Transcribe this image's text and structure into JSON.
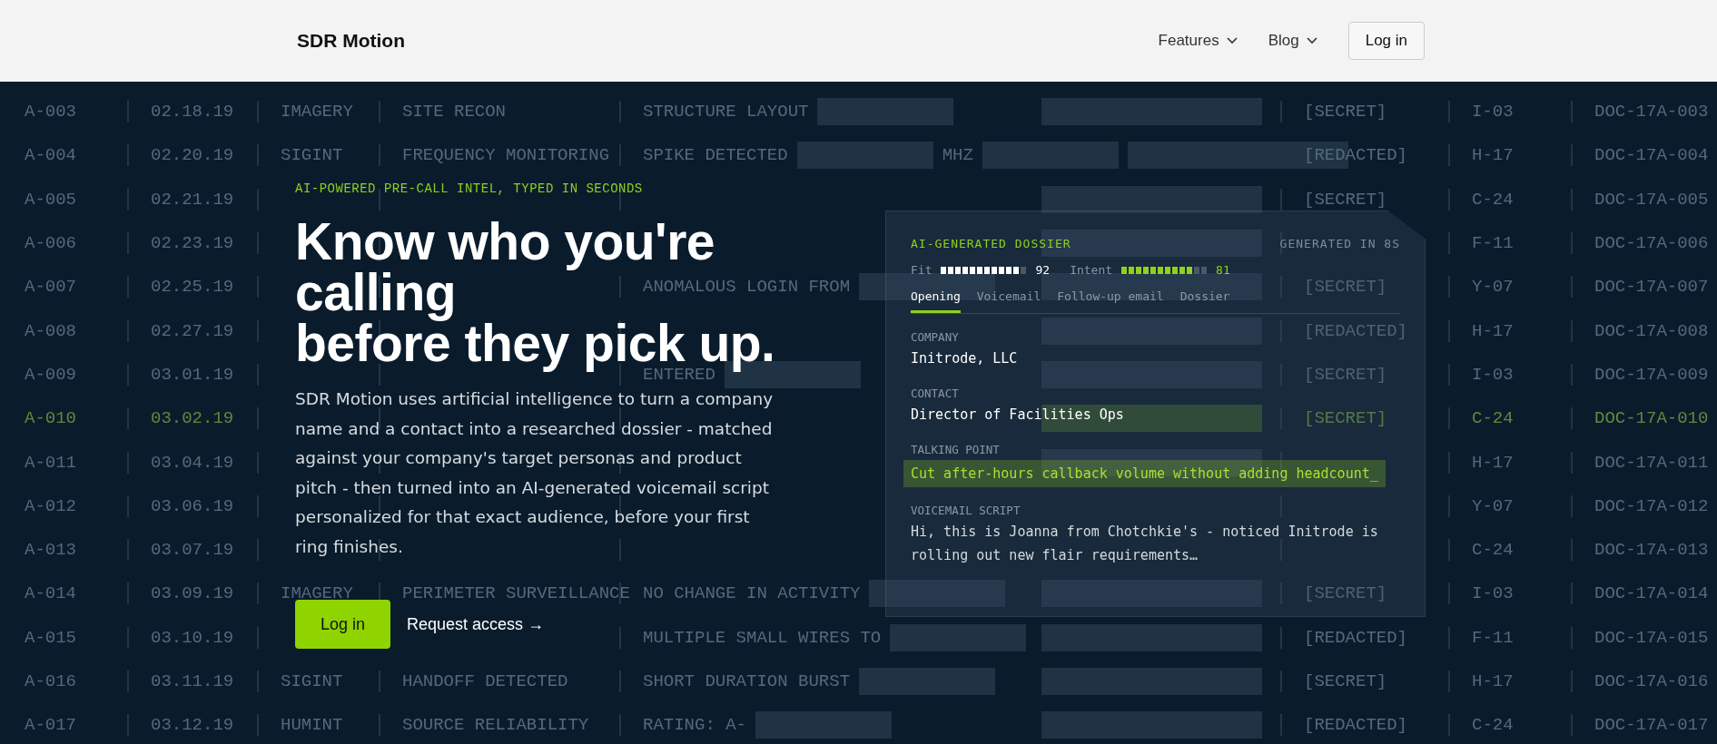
{
  "nav": {
    "logo": "SDR Motion",
    "menus": [
      {
        "label": "Features"
      },
      {
        "label": "Blog"
      }
    ],
    "login": "Log in"
  },
  "log_rows": [
    {
      "id": "A-003",
      "date": "02.18.19",
      "type": "IMAGERY",
      "activity": "SITE RECON",
      "finding": [
        "STRUCTURE LAYOUT"
      ],
      "class": "[SECRET]",
      "code": "I-03",
      "doc": "DOC-17A-003",
      "highlighted": false,
      "tail_bar": true
    },
    {
      "id": "A-004",
      "date": "02.20.19",
      "type": "SIGINT",
      "activity": "FREQUENCY MONITORING",
      "finding": [
        "SPIKE DETECTED",
        "MHZ"
      ],
      "class": "[REDACTED]",
      "code": "H-17",
      "doc": "DOC-17A-004",
      "highlighted": false,
      "tail_bar": true
    },
    {
      "id": "A-005",
      "date": "02.21.19",
      "class": "[SECRET]",
      "code": "C-24",
      "doc": "DOC-17A-005",
      "highlighted": false,
      "tail_bar": true
    },
    {
      "id": "A-006",
      "date": "02.23.19",
      "code": "F-11",
      "doc": "DOC-17A-006",
      "highlighted": false,
      "tail_bar": true
    },
    {
      "id": "A-007",
      "date": "02.25.19",
      "finding": [
        "ANOMALOUS LOGIN FROM"
      ],
      "class": "[SECRET]",
      "code": "Y-07",
      "doc": "DOC-17A-007",
      "highlighted": false,
      "tail_bar": true
    },
    {
      "id": "A-008",
      "date": "02.27.19",
      "class": "[REDACTED]",
      "code": "H-17",
      "doc": "DOC-17A-008",
      "highlighted": false,
      "tail_bar": true
    },
    {
      "id": "A-009",
      "date": "03.01.19",
      "finding": [
        "ENTERED"
      ],
      "class": "[SECRET]",
      "code": "I-03",
      "doc": "DOC-17A-009",
      "highlighted": false,
      "tail_bar": true
    },
    {
      "id": "A-010",
      "date": "03.02.19",
      "class": "[SECRET]",
      "code": "C-24",
      "doc": "DOC-17A-010",
      "highlighted": true,
      "tail_bar": true
    },
    {
      "id": "A-011",
      "date": "03.04.19",
      "code": "H-17",
      "doc": "DOC-17A-011",
      "highlighted": false,
      "tail_bar": true
    },
    {
      "id": "A-012",
      "date": "03.06.19",
      "code": "Y-07",
      "doc": "DOC-17A-012",
      "highlighted": false,
      "tail_bar": false
    },
    {
      "id": "A-013",
      "date": "03.07.19",
      "code": "C-24",
      "doc": "DOC-17A-013",
      "highlighted": false,
      "tail_bar": false
    },
    {
      "id": "A-014",
      "date": "03.09.19",
      "type": "IMAGERY",
      "activity": "PERIMETER SURVEILLANCE",
      "finding": [
        "NO CHANGE IN ACTIVITY"
      ],
      "class": "[SECRET]",
      "code": "I-03",
      "doc": "DOC-17A-014",
      "highlighted": false,
      "tail_bar": true
    },
    {
      "id": "A-015",
      "date": "03.10.19",
      "finding": [
        "MULTIPLE SMALL WIRES TO"
      ],
      "class": "[REDACTED]",
      "code": "F-11",
      "doc": "DOC-17A-015",
      "highlighted": false,
      "tail_bar": true
    },
    {
      "id": "A-016",
      "date": "03.11.19",
      "type": "SIGINT",
      "activity": "HANDOFF DETECTED",
      "finding": [
        "SHORT DURATION BURST"
      ],
      "class": "[SECRET]",
      "code": "H-17",
      "doc": "DOC-17A-016",
      "highlighted": false,
      "tail_bar": true
    },
    {
      "id": "A-017",
      "date": "03.12.19",
      "type": "HUMINT",
      "activity": "SOURCE RELIABILITY",
      "finding": [
        "RATING: A-"
      ],
      "class": "[REDACTED]",
      "code": "C-24",
      "doc": "DOC-17A-017",
      "highlighted": false,
      "tail_bar": true
    }
  ],
  "hero": {
    "eyebrow": "AI-POWERED PRE-CALL INTEL, TYPED IN SECONDS",
    "heading_lines": [
      "Know who you're",
      "calling",
      "before they pick up."
    ],
    "body": "SDR Motion uses artificial intelligence to turn a company name and a contact into a researched dossier - matched against your company's target personas and product pitch - then turned into an AI-generated voicemail script personalized for that exact audience, before your first ring finishes.",
    "primary_button": "Log in",
    "secondary_link": "Request access →"
  },
  "dossier": {
    "title": "AI-GENERATED DOSSIER",
    "generated": "GENERATED IN 8S",
    "meters": [
      {
        "label": "Fit",
        "level": 0.92,
        "value": "92",
        "kind": "white"
      },
      {
        "label": "Intent",
        "level": 0.81,
        "value": "81",
        "kind": "green"
      }
    ],
    "tabs": [
      {
        "label": "Opening",
        "selected": true
      },
      {
        "label": "Voicemail",
        "selected": false
      },
      {
        "label": "Follow-up email",
        "selected": false
      },
      {
        "label": "Dossier",
        "selected": false
      }
    ],
    "fields": [
      {
        "label": "COMPANY",
        "value": "Initrode, LLC",
        "kind": "plain"
      },
      {
        "label": "CONTACT",
        "value": "Director of Facilities Ops",
        "kind": "plain"
      },
      {
        "label": "TALKING POINT",
        "value": "Cut after-hours callback volume without adding headcount_",
        "kind": "highlight"
      },
      {
        "label": "VOICEMAIL SCRIPT",
        "value": "Hi, this is Joanna from Chotchkie's - noticed Initrode is rolling out new flair requirements…",
        "kind": "muted"
      }
    ]
  }
}
